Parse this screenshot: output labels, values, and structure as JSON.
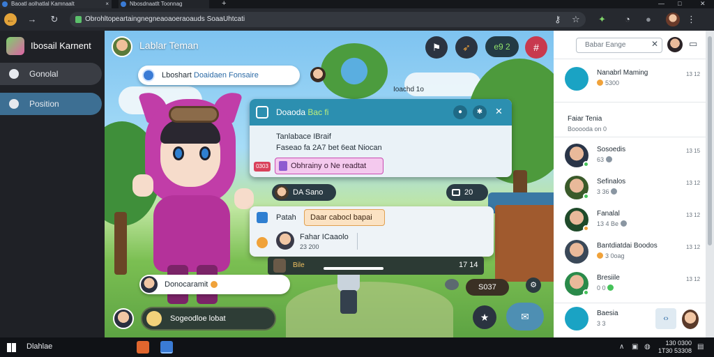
{
  "browser": {
    "tabs": [
      {
        "label": "Baoatl aolhatlal Kamnaalt",
        "close": "×"
      },
      {
        "label": "Nbosdnaatlt Toonnag"
      }
    ],
    "new_tab": "+",
    "window_controls": {
      "minimize": "—",
      "maximize": "□",
      "close": "✕"
    },
    "url": "Obrohltopeartaingnegneaoaoeraoauds SoaaUhtcati"
  },
  "sidebar": {
    "app_name": "Ibosail Karnent",
    "items": [
      {
        "label": "Gonolal"
      },
      {
        "label": "Position"
      }
    ]
  },
  "scene": {
    "title": "Lablar Teman",
    "hud_score": "e9 2",
    "float_label": "Ioachd 1o",
    "message_1": {
      "lead": "Lboshart",
      "highlight": "Doaidaen Fonsaire"
    },
    "dialog": {
      "title": "Doaoda",
      "title_accent": "Bac fi",
      "line_1": "Tanlabace IBraif",
      "line_2": "Faseao fa 2A7 bet 6eat Niocan",
      "badge": "0303",
      "action": "Obhrainy o Ne readtat"
    },
    "chip_1": "DA Sano",
    "chip_2": "20",
    "card": {
      "label": "Patah",
      "input_value": "Daar cabocl bapai",
      "name": "Fahar ICaaolo",
      "sub": "23 200"
    },
    "bar": {
      "label": "Bile",
      "count": "17 14",
      "progress": 0.35
    },
    "chip_3": "S037",
    "message_2": {
      "text": "Donocaramit"
    },
    "chat_input": "Sogeodloe lobat"
  },
  "right_panel": {
    "search_placeholder": "Babar Eange",
    "items": [
      {
        "name": "Nanabrl Maming",
        "sub": "5300",
        "time": "13 12",
        "avatar_color": "#1aa3c4"
      },
      {
        "name": "Faiar Tenia",
        "sub": "Booooda on 0",
        "time": "",
        "avatar_color": "#ffffff"
      },
      {
        "name": "Sosoedis",
        "sub": "63",
        "time": "13 15",
        "avatar_color": "#2a3548"
      },
      {
        "name": "Sefinalos",
        "sub": "3 36",
        "time": "13 12",
        "avatar_color": "#3a5a2a"
      },
      {
        "name": "Fanalal",
        "sub": "13 4 Be",
        "time": "13 12",
        "avatar_color": "#1f4a2a"
      },
      {
        "name": "Bantdiatdai Boodos",
        "sub": "3 0oag",
        "time": "13 12",
        "avatar_color": "#3a4858"
      },
      {
        "name": "Bresiile",
        "sub": "0 0",
        "time": "13 12",
        "avatar_color": "#2a8a4a"
      }
    ],
    "footer": {
      "name": "Baesia",
      "sub": "3 3"
    }
  },
  "taskbar": {
    "search_text": "Dlahlae",
    "clock_time": "130 0300",
    "clock_date": "1T30 53308"
  },
  "colors": {
    "sidebar_active": "#3d6f93",
    "dialog_header": "#2c8fb0",
    "accent_pink": "#c13da8",
    "online": "#46c25a"
  },
  "icons": {
    "back": "back-arrow-icon",
    "forward": "forward-arrow-icon",
    "reload": "reload-icon",
    "star": "star-icon",
    "extension": "extension-icon",
    "timer": "timer-icon"
  }
}
